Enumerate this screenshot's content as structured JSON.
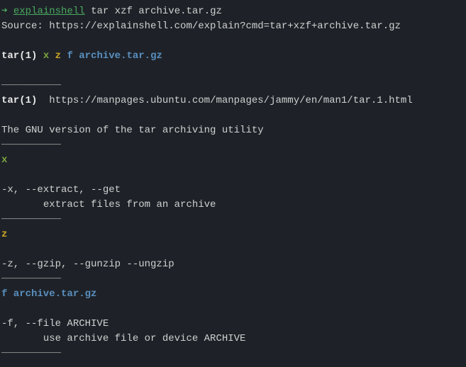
{
  "prompt": {
    "arrow": "➜",
    "command": "explainshell",
    "args": " tar xzf archive.tar.gz"
  },
  "source_label": "Source: ",
  "source_url": "https://explainshell.com/explain?cmd=tar+xzf+archive.tar.gz",
  "header": {
    "cmd": "tar(1)",
    "space": " ",
    "x": "x",
    "z": "z",
    "f_arg": "f archive.tar.gz"
  },
  "divider": "──────────",
  "sections": {
    "tar": {
      "title": "tar(1)",
      "url_prefix": "  ",
      "url": "https://manpages.ubuntu.com/manpages/jammy/en/man1/tar.1.html",
      "desc": "The GNU version of the tar archiving utility"
    },
    "x": {
      "title": "x",
      "desc": "-x, --extract, --get\n       extract files from an archive"
    },
    "z": {
      "title": "z",
      "desc": "-z, --gzip, --gunzip --ungzip"
    },
    "f": {
      "title": "f archive.tar.gz",
      "desc": "-f, --file ARCHIVE\n       use archive file or device ARCHIVE"
    }
  }
}
